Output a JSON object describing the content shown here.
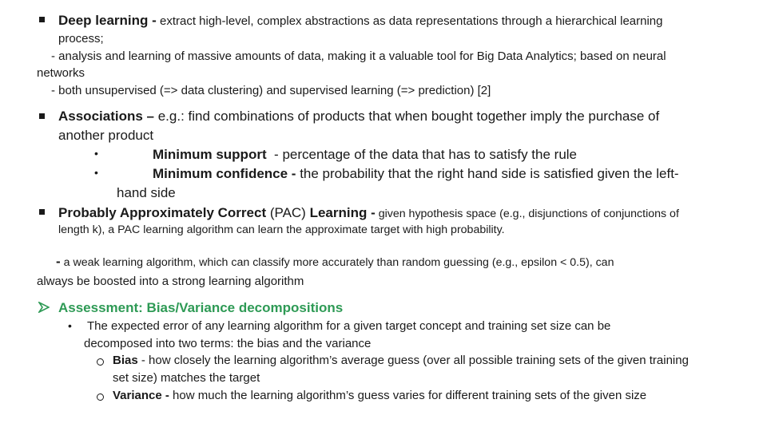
{
  "colors": {
    "text": "#1a1a1a",
    "accent_green": "#2e9a55"
  },
  "deep_learning": {
    "bullet_icon": "square-bullet",
    "term": "Deep learning -",
    "line1": " extract high-level, complex abstractions as data representations through a hierarchical learning",
    "line2": "process;",
    "line3": "- analysis and learning of massive amounts of data, making it a valuable tool for Big Data Analytics; based on neural",
    "line4": "networks",
    "line5": "- both unsupervised (=> data clustering) and supervised learning (=> prediction) [2]"
  },
  "associations": {
    "bullet_icon": "square-bullet",
    "term": "Associations –",
    "line1": " e.g.: find combinations of products that when bought together imply the purchase of",
    "line2": "another product",
    "sub_items": [
      {
        "bullet_icon": "dot-bullet",
        "term": "Minimum support",
        "text": "  - percentage of the data that has to satisfy the rule"
      },
      {
        "bullet_icon": "dot-bullet",
        "term": "Minimum confidence -",
        "text": " the probability that the right hand side is satisfied given the left-",
        "continuation": "hand side"
      }
    ]
  },
  "pac": {
    "bullet_icon": "square-bullet",
    "term": "Probably Approximately Correct",
    "term2": " (PAC) ",
    "term3": "Learning -",
    "line1": " given hypothesis space (e.g., disjunctions of conjunctions of",
    "line2": "length k), a PAC learning algorithm can learn the approximate target with high probability.",
    "line3_dash": "-",
    "line3": " a weak learning algorithm, which can classify more accurately than random guessing (e.g., epsilon < 0.5), can",
    "line4": "always be boosted into a strong learning algorithm"
  },
  "assessment": {
    "bullet_icon": "arrow-bullet",
    "heading": "Assessment: Bias/Variance decompositions",
    "item": {
      "bullet_icon": "dot-bullet",
      "line1": "The expected error of any learning algorithm for a given target concept and training set size can be",
      "line2": "decomposed into two terms: the bias and the variance"
    },
    "sub_items": [
      {
        "bullet_icon": "circle-bullet",
        "term": "Bias",
        "text": " - how closely the learning algorithm’s average guess (over all possible training sets of the given training",
        "continuation": "set size) matches the target"
      },
      {
        "bullet_icon": "circle-bullet",
        "term": "Variance -",
        "text": " how much the learning algorithm’s guess varies for different training sets of the given size"
      }
    ]
  }
}
